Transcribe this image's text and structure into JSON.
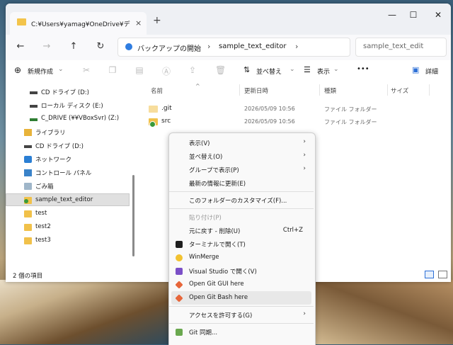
{
  "tab": {
    "title": "C:¥Users¥yamag¥OneDrive¥デ",
    "close": "×",
    "new": "+"
  },
  "window_controls": {
    "minimize": "—",
    "maximize": "☐",
    "close": "✕"
  },
  "nav": {
    "back": "←",
    "forward": "→",
    "up": "↑",
    "refresh": "↻"
  },
  "address": {
    "root": "バックアップの開始",
    "sep1": "›",
    "current": "sample_text_editor",
    "sep2": "›"
  },
  "search": {
    "placeholder": "sample_text_edit"
  },
  "toolbar": {
    "new_label": "新規作成",
    "sort_label": "並べ替え",
    "view_label": "表示",
    "more": "•••",
    "details_label": "詳細"
  },
  "sidebar": {
    "items": [
      {
        "label": "CD ドライブ (D:)",
        "icon": "drive-icon"
      },
      {
        "label": "ローカル ディスク (E:)",
        "icon": "drive-icon"
      },
      {
        "label": "C_DRIVE (¥¥VBoxSvr) (Z:)",
        "icon": "network-drive-icon"
      },
      {
        "label": "ライブラリ",
        "icon": "library-icon"
      },
      {
        "label": "CD ドライブ (D:)",
        "icon": "drive-icon"
      },
      {
        "label": "ネットワーク",
        "icon": "network-icon"
      },
      {
        "label": "コントロール パネル",
        "icon": "control-panel-icon"
      },
      {
        "label": "ごみ箱",
        "icon": "recycle-bin-icon"
      },
      {
        "label": "sample_text_editor",
        "icon": "git-folder-icon"
      },
      {
        "label": "test",
        "icon": "folder-icon"
      },
      {
        "label": "test2",
        "icon": "folder-icon"
      },
      {
        "label": "test3",
        "icon": "folder-icon"
      }
    ]
  },
  "columns": {
    "name": "名前",
    "date": "更新日時",
    "type": "種類",
    "size": "サイズ"
  },
  "files": [
    {
      "name": ".git",
      "date": "2026/05/09 10:56",
      "type": "ファイル フォルダー"
    },
    {
      "name": "src",
      "date": "2026/05/09 10:56",
      "type": "ファイル フォルダー"
    }
  ],
  "status": {
    "count": "2 個の項目"
  },
  "context_menu": {
    "items": [
      {
        "label": "表示(V)",
        "submenu": true
      },
      {
        "label": "並べ替え(O)",
        "submenu": true
      },
      {
        "label": "グループで表示(P)",
        "submenu": true
      },
      {
        "label": "最新の情報に更新(E)"
      },
      {
        "label": "このフォルダーのカスタマイズ(F)..."
      },
      {
        "label": "貼り付け(P)",
        "disabled": true
      },
      {
        "label": "元に戻す - 削除(U)",
        "shortcut": "Ctrl+Z"
      },
      {
        "label": "ターミナルで開く(T)",
        "icon": "terminal-icon"
      },
      {
        "label": "WinMerge",
        "icon": "winmerge-icon"
      },
      {
        "label": "Visual Studio で開く(V)",
        "icon": "visual-studio-icon"
      },
      {
        "label": "Open Git GUI here",
        "icon": "git-icon"
      },
      {
        "label": "Open Git Bash here",
        "icon": "git-icon",
        "highlighted": true
      },
      {
        "label": "アクセスを許可する(G)",
        "submenu": true
      },
      {
        "label": "Git 同期...",
        "icon": "git-sync-icon"
      }
    ]
  },
  "colors": {
    "accent": "#2c6fd6",
    "folder": "#f1c14a",
    "git": "#3a9a3a"
  }
}
